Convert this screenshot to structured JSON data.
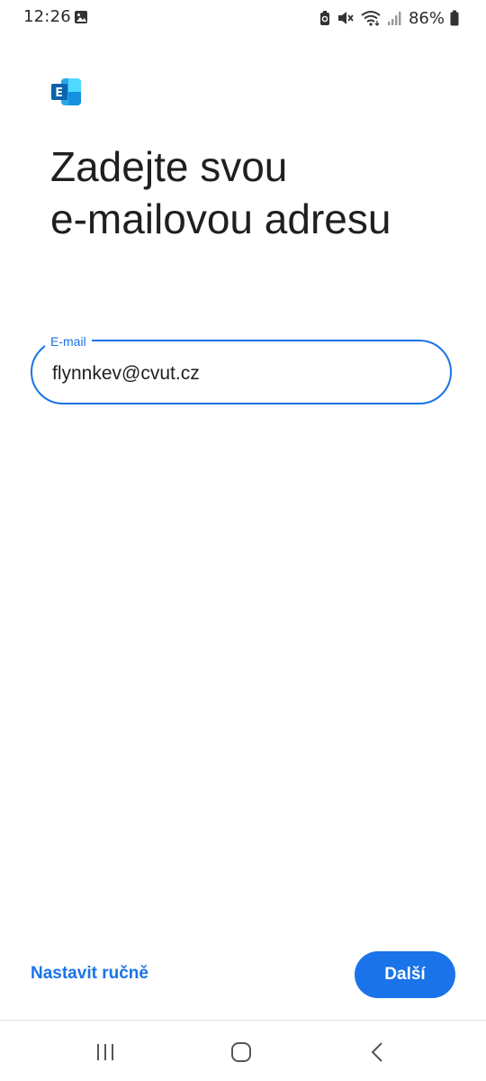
{
  "status_bar": {
    "time": "12:26",
    "battery_percent": "86%",
    "icons": [
      "gallery-icon",
      "battery-saver-icon",
      "mute-icon",
      "wifi-icon",
      "signal-icon",
      "battery-icon"
    ]
  },
  "app": {
    "logo_icon": "exchange-logo-icon",
    "accent_color": "#1a73e8"
  },
  "title": {
    "line1": "Zadejte svou",
    "line2": "e-mailovou adresu"
  },
  "email_field": {
    "label": "E-mail",
    "value": "flynnkev@cvut.cz"
  },
  "actions": {
    "manual_label": "Nastavit ručně",
    "next_label": "Další"
  },
  "nav_bar": {
    "buttons": [
      "recents-icon",
      "home-icon",
      "back-icon"
    ]
  }
}
